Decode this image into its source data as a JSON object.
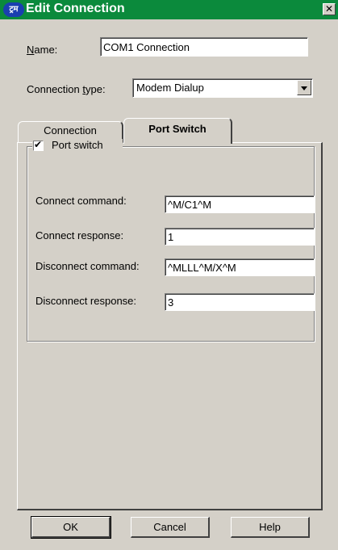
{
  "window": {
    "title": "Edit Connection",
    "icon_text": "ट्रम",
    "close_symbol": "✕"
  },
  "form": {
    "name_label_u": "N",
    "name_label_rest": "ame:",
    "name_value": "COM1 Connection",
    "conn_type_label_pre": "Connection ",
    "conn_type_label_u": "t",
    "conn_type_label_rest": "ype:",
    "conn_type_value": "Modem Dialup"
  },
  "tabs": [
    {
      "label": "Connection",
      "active": false
    },
    {
      "label": "Port Switch",
      "active": true
    }
  ],
  "port_switch": {
    "group_label": "Port switch",
    "checked": true,
    "fields": [
      {
        "label": "Connect command:",
        "value": "^M/C1^M"
      },
      {
        "label": "Connect response:",
        "value": "1"
      },
      {
        "label": "Disconnect command:",
        "value": "^MLLL^M/X^M"
      },
      {
        "label": "Disconnect response:",
        "value": "3"
      }
    ]
  },
  "buttons": {
    "ok": "OK",
    "cancel": "Cancel",
    "help": "Help"
  }
}
